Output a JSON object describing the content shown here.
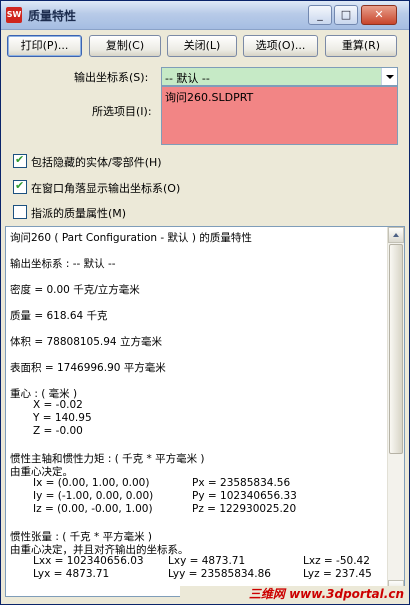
{
  "window": {
    "title": "质量特性",
    "app_icon": "SW",
    "controls": {
      "minimize": "_",
      "restore": "□",
      "close": "✕"
    }
  },
  "toolbar": {
    "print_label": "打印(P)...",
    "copy_label": "复制(C)",
    "close_label": "关闭(L)",
    "options_label": "选项(O)...",
    "recalc_label": "重算(R)"
  },
  "form": {
    "output_cs_label": "输出坐标系(S):",
    "output_cs_value": "-- 默认 --",
    "selected_items_label": "所选项目(I):",
    "selected_items": [
      "询问260.SLDPRT"
    ]
  },
  "options": {
    "include_hidden_label": "包括隐藏的实体/零部件(H)",
    "include_hidden_checked": true,
    "show_output_cs_label": "在窗口角落显示输出坐标系(O)",
    "show_output_cs_checked": true,
    "assigned_mass_label": "指派的质量属性(M)",
    "assigned_mass_checked": false
  },
  "results": {
    "heading": "询问260 ( Part Configuration - 默认 ) 的质量特性",
    "output_cs": "输出坐标系 : -- 默认 --",
    "density": "密度 = 0.00 千克/立方毫米",
    "mass": "质量 = 618.64 千克",
    "volume": "体积 = 78808105.94 立方毫米",
    "surface_area": "表面积 = 1746996.90 平方毫米",
    "center_of_mass_title": "重心 : ( 毫米 )",
    "com_x": "X = -0.02",
    "com_y": "Y = 140.95",
    "com_z": "Z = -0.00",
    "principal_title": "惯性主轴和惯性力矩 : ( 千克 * 平方毫米 )",
    "principal_sub": "由重心决定。",
    "ix": "Ix = (0.00, 1.00, 0.00)",
    "px": "Px = 23585834.56",
    "iy": "Iy = (-1.00, 0.00, 0.00)",
    "py": "Py = 102340656.33",
    "iz": "Iz = (0.00, -0.00, 1.00)",
    "pz": "Pz = 122930025.20",
    "tensor_title": "惯性张量 : ( 千克 * 平方毫米 )",
    "tensor_sub": "由重心决定，并且对齐输出的坐标系。",
    "lxx": "Lxx = 102340656.03",
    "lxy": "Lxy = 4873.71",
    "lxz": "Lxz = -50.42",
    "lyx": "Lyx = 4873.71",
    "lyy": "Lyy = 23585834.86",
    "lyz": "Lyz = 237.45"
  },
  "watermark": "三维网 www.3dportal.cn"
}
